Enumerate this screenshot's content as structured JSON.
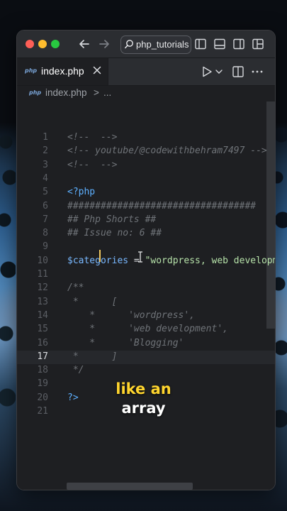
{
  "titlebar": {
    "search_text": "php_tutorials",
    "colors": {
      "close": "#fe5f57",
      "minimize": "#febc2e",
      "maximize": "#28c840"
    }
  },
  "tab": {
    "icon_label": "php",
    "label": "index.php"
  },
  "breadcrumb": {
    "icon_label": "php",
    "file": "index.php",
    "separator": ">",
    "more": "..."
  },
  "editor": {
    "current_line": 17,
    "lines": [
      {
        "num": "1",
        "parts": [
          {
            "t": "<!--  -->",
            "c": "comment"
          }
        ]
      },
      {
        "num": "2",
        "parts": [
          {
            "t": "<!-- youtube/@codewithbehram7497 -->",
            "c": "comment"
          }
        ]
      },
      {
        "num": "3",
        "parts": [
          {
            "t": "<!--  -->",
            "c": "comment"
          }
        ]
      },
      {
        "num": "4",
        "parts": []
      },
      {
        "num": "5",
        "parts": [
          {
            "t": "<?php",
            "c": "c-kw"
          }
        ]
      },
      {
        "num": "6",
        "parts": [
          {
            "t": "##################################",
            "c": "comment"
          }
        ]
      },
      {
        "num": "7",
        "parts": [
          {
            "t": "## Php Shorts ##",
            "c": "comment"
          }
        ]
      },
      {
        "num": "8",
        "parts": [
          {
            "t": "## Issue no: 6 ##",
            "c": "comment"
          }
        ]
      },
      {
        "num": "9",
        "parts": []
      },
      {
        "num": "10",
        "parts": [
          {
            "t": "$categories",
            "c": "c-var"
          },
          {
            "t": " = ",
            "c": "c-op"
          },
          {
            "t": "\"wordpress, web developm",
            "c": "c-str"
          }
        ]
      },
      {
        "num": "11",
        "parts": []
      },
      {
        "num": "12",
        "parts": [
          {
            "t": "/**",
            "c": "comment"
          }
        ]
      },
      {
        "num": "13",
        "parts": [
          {
            "t": " *      [",
            "c": "comment"
          }
        ]
      },
      {
        "num": "14",
        "parts": [
          {
            "t": "    *      'wordpress',",
            "c": "comment"
          }
        ]
      },
      {
        "num": "15",
        "parts": [
          {
            "t": "    *      'web development',",
            "c": "comment"
          }
        ]
      },
      {
        "num": "16",
        "parts": [
          {
            "t": "    *      'Blogging'",
            "c": "comment"
          }
        ]
      },
      {
        "num": "17",
        "parts": [
          {
            "t": " *      ]",
            "c": "comment"
          }
        ]
      },
      {
        "num": "18",
        "parts": [
          {
            "t": " */",
            "c": "comment"
          }
        ]
      },
      {
        "num": "19",
        "parts": []
      },
      {
        "num": "20",
        "parts": [
          {
            "t": "?>",
            "c": "c-kw"
          }
        ]
      },
      {
        "num": "21",
        "parts": []
      }
    ]
  },
  "caption": {
    "line1": "like an",
    "line2": "array"
  }
}
